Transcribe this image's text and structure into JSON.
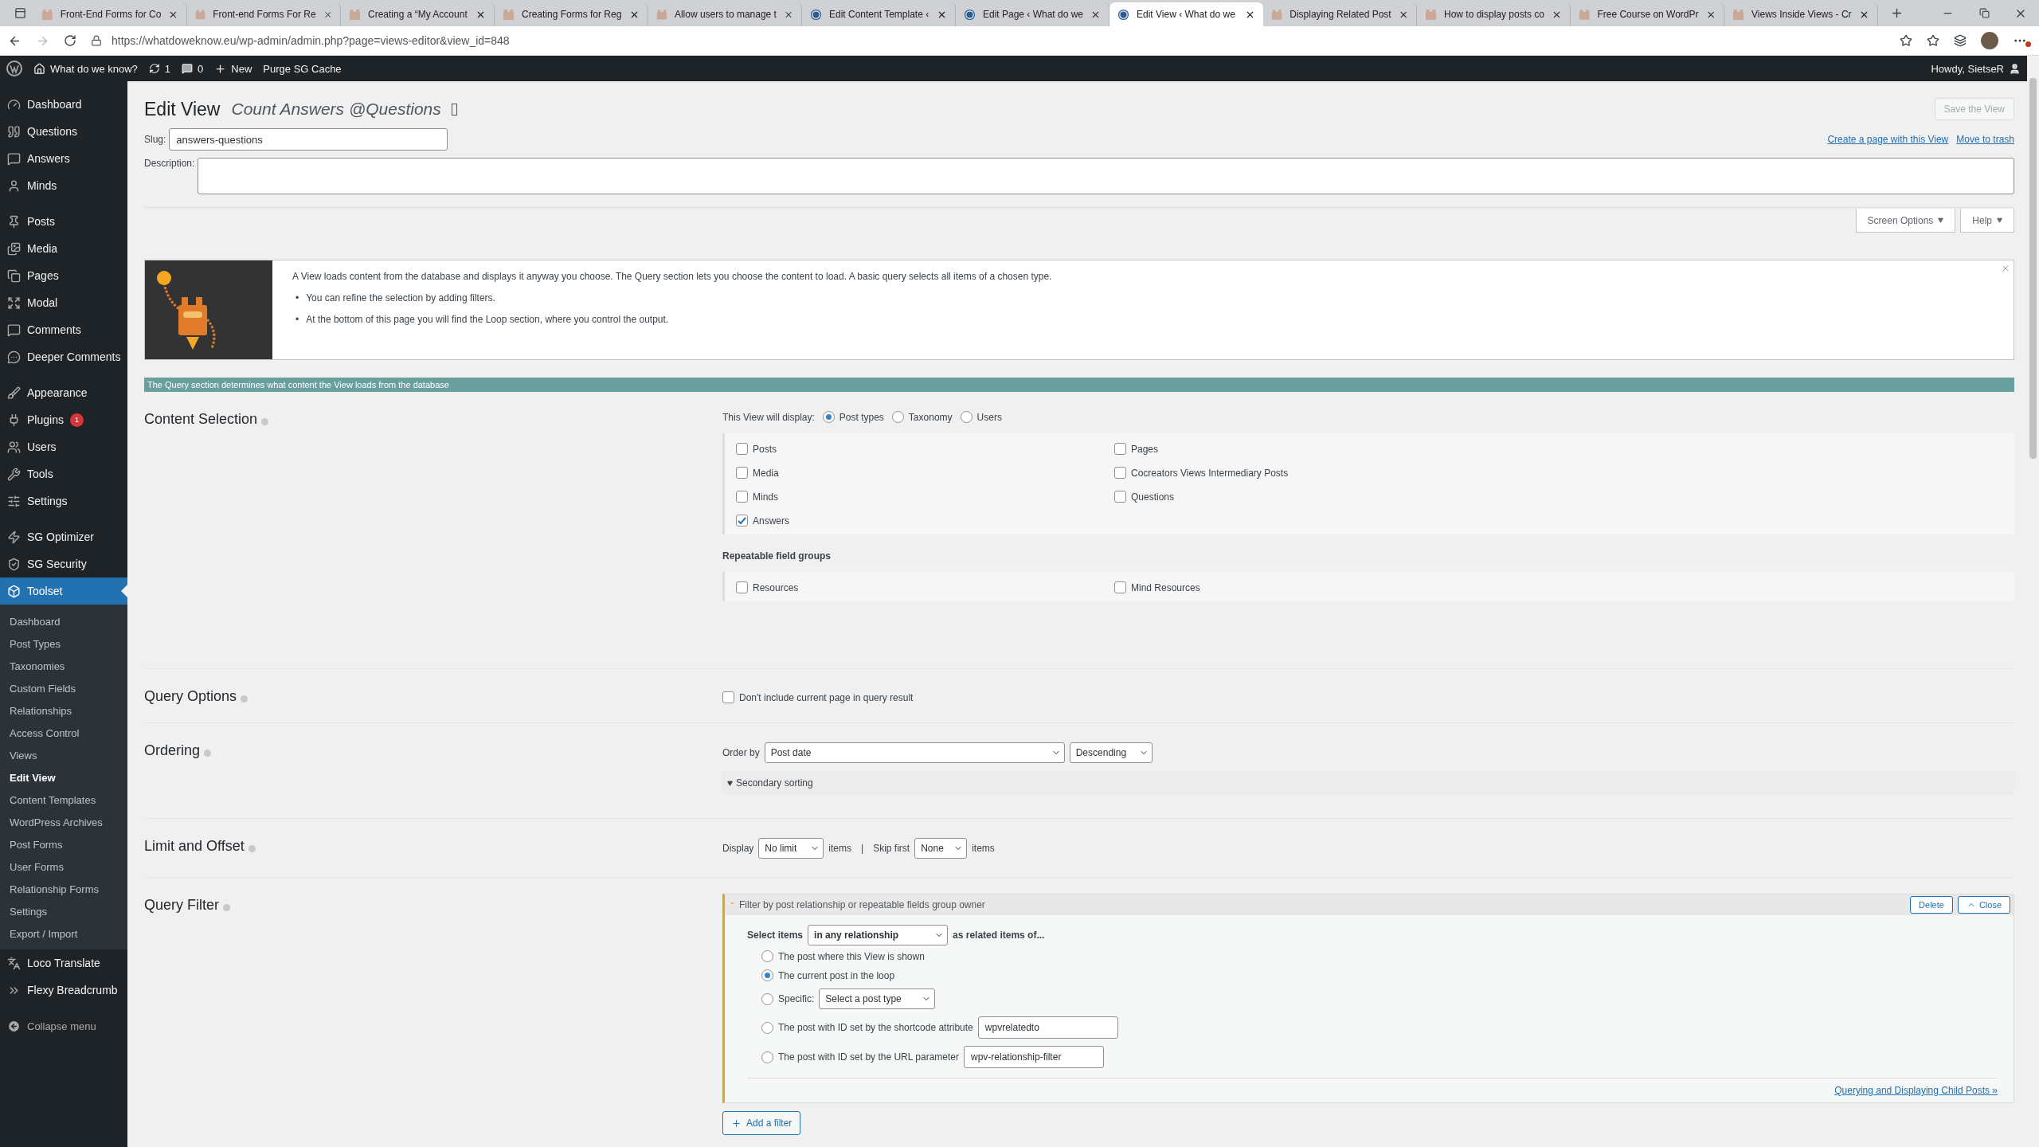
{
  "browser": {
    "tabs": [
      {
        "title": "Front-End Forms for Co",
        "kind": "toolset",
        "selected": false
      },
      {
        "title": "Front-end Forms For Re",
        "kind": "toolset",
        "selected": false
      },
      {
        "title": "Creating a “My Account",
        "kind": "toolset",
        "selected": false
      },
      {
        "title": "Creating Forms for Reg",
        "kind": "toolset",
        "selected": false
      },
      {
        "title": "Allow users to manage t",
        "kind": "toolset",
        "selected": false
      },
      {
        "title": "Edit Content Template ‹",
        "kind": "wordpress",
        "selected": false
      },
      {
        "title": "Edit Page ‹ What do we",
        "kind": "wordpress",
        "selected": false
      },
      {
        "title": "Edit View ‹ What do we",
        "kind": "wordpress",
        "selected": true
      },
      {
        "title": "Displaying Related Post",
        "kind": "toolset",
        "selected": false
      },
      {
        "title": "How to display posts co",
        "kind": "toolset",
        "selected": false
      },
      {
        "title": "Free Course on WordPr",
        "kind": "toolset",
        "selected": false
      },
      {
        "title": "Views Inside Views - Cr",
        "kind": "toolset",
        "selected": false
      }
    ],
    "url": "https://whatdoweknow.eu/wp-admin/admin.php?page=views-editor&view_id=848"
  },
  "admin_bar": {
    "site_name": "What do we know?",
    "updates": "1",
    "comments": "0",
    "new": "New",
    "purge": "Purge SG Cache",
    "howdy": "Howdy, SietseR"
  },
  "sidebar": {
    "groups": [
      [
        {
          "label": "Dashboard",
          "selected": false
        },
        {
          "label": "Questions",
          "selected": false
        },
        {
          "label": "Answers",
          "selected": false
        },
        {
          "label": "Minds",
          "selected": false
        }
      ],
      [
        {
          "label": "Posts",
          "selected": false
        },
        {
          "label": "Media",
          "selected": false
        },
        {
          "label": "Pages",
          "selected": false
        },
        {
          "label": "Modal",
          "selected": false
        },
        {
          "label": "Comments",
          "selected": false
        },
        {
          "label": "Deeper Comments",
          "selected": false
        }
      ],
      [
        {
          "label": "Appearance",
          "selected": false
        },
        {
          "label": "Plugins",
          "badge": "1",
          "selected": false
        },
        {
          "label": "Users",
          "selected": false
        },
        {
          "label": "Tools",
          "selected": false
        },
        {
          "label": "Settings",
          "selected": false
        }
      ],
      [
        {
          "label": "SG Optimizer",
          "selected": false
        },
        {
          "label": "SG Security",
          "selected": false
        },
        {
          "label": "Toolset",
          "selected": true,
          "children": [
            {
              "label": "Dashboard",
              "selected": false
            },
            {
              "label": "Post Types",
              "selected": false
            },
            {
              "label": "Taxonomies",
              "selected": false
            },
            {
              "label": "Custom Fields",
              "selected": false
            },
            {
              "label": "Relationships",
              "selected": false
            },
            {
              "label": "Access Control",
              "selected": false
            },
            {
              "label": "Views",
              "selected": false
            },
            {
              "label": "Edit View",
              "selected": true
            },
            {
              "label": "Content Templates",
              "selected": false
            },
            {
              "label": "WordPress Archives",
              "selected": false
            },
            {
              "label": "Post Forms",
              "selected": false
            },
            {
              "label": "User Forms",
              "selected": false
            },
            {
              "label": "Relationship Forms",
              "selected": false
            },
            {
              "label": "Settings",
              "selected": false
            },
            {
              "label": "Export / Import",
              "selected": false
            }
          ]
        },
        {
          "label": "Loco Translate",
          "selected": false
        },
        {
          "label": "Flexy Breadcrumb",
          "selected": false
        }
      ]
    ],
    "collapse": "Collapse menu"
  },
  "header": {
    "title": "Edit View",
    "view_name": "Count Answers @Questions",
    "save": "Save the View",
    "slug_label": "Slug:",
    "slug": "answers-questions",
    "description_label": "Description:",
    "links": [
      "Create a page with this View",
      "Move to trash"
    ],
    "screen_options": "Screen Options",
    "help": "Help"
  },
  "notice": {
    "marker": "•",
    "intro": "A View loads content from the database and displays it anyway you choose. The Query section lets you choose the content to load. A basic query selects all items of a chosen type.",
    "bullets": [
      "You can refine the selection by adding filters.",
      "At the bottom of this page you will find the Loop section, where you control the output."
    ]
  },
  "banner": "The Query section determines what content the View loads from the database",
  "content_selection": {
    "title": "Content Selection",
    "display_label": "This View will display:",
    "display_options": [
      {
        "label": "Post types",
        "selected": true
      },
      {
        "label": "Taxonomy",
        "selected": false
      },
      {
        "label": "Users",
        "selected": false
      }
    ],
    "post_types": [
      [
        {
          "label": "Posts",
          "checked": false
        },
        {
          "label": "Media",
          "checked": false
        },
        {
          "label": "Minds",
          "checked": false
        },
        {
          "label": "Answers",
          "checked": true
        }
      ],
      [
        {
          "label": "Pages",
          "checked": false
        },
        {
          "label": "Cocreators Views Intermediary Posts",
          "checked": false
        },
        {
          "label": "Questions",
          "checked": false
        }
      ]
    ],
    "repeatable_title": "Repeatable field groups",
    "repeatable_groups": [
      [
        {
          "label": "Resources",
          "checked": false
        }
      ],
      [
        {
          "label": "Mind Resources",
          "checked": false
        }
      ]
    ]
  },
  "query_options": {
    "title": "Query Options",
    "options": [
      {
        "label": "Don't include current page in query result",
        "checked": false
      }
    ]
  },
  "ordering": {
    "title": "Ordering",
    "order_by_label": "Order by",
    "order_by": "Post date",
    "direction": "Descending",
    "secondary": "Secondary sorting"
  },
  "limit_offset": {
    "title": "Limit and Offset",
    "display_label": "Display",
    "limit": "No limit",
    "items_label": "items",
    "separator": "|",
    "skip_label": "Skip first",
    "skip": "None",
    "skip_items_label": "items"
  },
  "query_filter": {
    "title": "Query Filter",
    "filter_title": "Filter by post relationship or repeatable fields group owner",
    "delete": "Delete",
    "close": "Close",
    "select_items_label": "Select items",
    "relationship": "in any relationship",
    "related_label": "as related items of...",
    "options": [
      {
        "label": "The post where this View is shown",
        "kind": "plain",
        "selected": false
      },
      {
        "label": "The current post in the loop",
        "kind": "plain",
        "selected": true
      },
      {
        "label": "Specific:",
        "kind": "select",
        "value": "Select a post type",
        "selected": false
      },
      {
        "label": "The post with ID set by the shortcode attribute",
        "kind": "input",
        "value": "wpvrelatedto",
        "selected": false
      },
      {
        "label": "The post with ID set by the URL parameter",
        "kind": "input",
        "value": "wpv-relationship-filter",
        "selected": false
      }
    ],
    "link": "Querying and Displaying Child Posts »",
    "add_filter": "Add a filter"
  }
}
